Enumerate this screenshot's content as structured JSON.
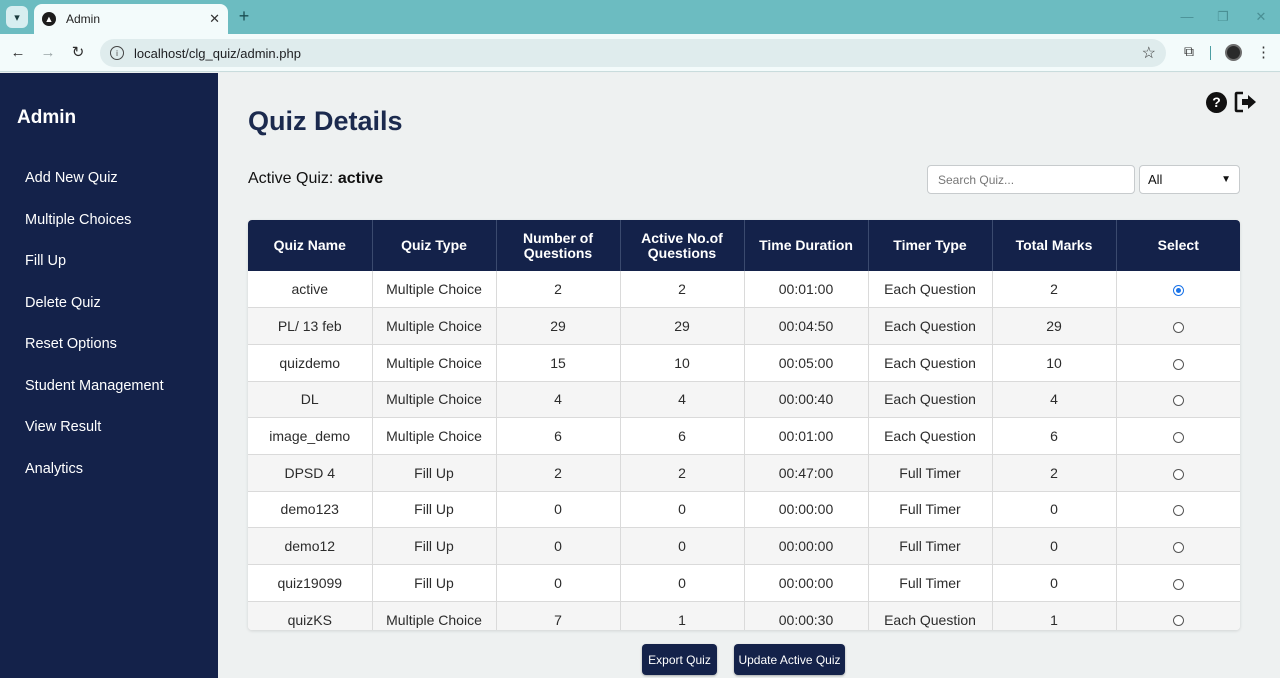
{
  "browser": {
    "tab_title": "Admin",
    "url": "localhost/clg_quiz/admin.php"
  },
  "sidebar": {
    "title": "Admin",
    "items": [
      {
        "label": "Add New Quiz"
      },
      {
        "label": "Multiple Choices"
      },
      {
        "label": "Fill Up"
      },
      {
        "label": "Delete Quiz"
      },
      {
        "label": "Reset Options"
      },
      {
        "label": "Student Management"
      },
      {
        "label": "View Result"
      },
      {
        "label": "Analytics"
      }
    ]
  },
  "main": {
    "title": "Quiz Details",
    "active_label": "Active Quiz:",
    "active_value": "active",
    "search_placeholder": "Search Quiz...",
    "filter_value": "All"
  },
  "table": {
    "headers": [
      "Quiz Name",
      "Quiz Type",
      "Number of Questions",
      "Active No.of Questions",
      "Time Duration",
      "Timer Type",
      "Total Marks",
      "Select"
    ],
    "rows": [
      {
        "name": "active",
        "type": "Multiple Choice",
        "num": "2",
        "active_num": "2",
        "duration": "00:01:00",
        "timer": "Each Question",
        "marks": "2",
        "selected": true
      },
      {
        "name": "PL/ 13 feb",
        "type": "Multiple Choice",
        "num": "29",
        "active_num": "29",
        "duration": "00:04:50",
        "timer": "Each Question",
        "marks": "29",
        "selected": false
      },
      {
        "name": "quizdemo",
        "type": "Multiple Choice",
        "num": "15",
        "active_num": "10",
        "duration": "00:05:00",
        "timer": "Each Question",
        "marks": "10",
        "selected": false
      },
      {
        "name": "DL",
        "type": "Multiple Choice",
        "num": "4",
        "active_num": "4",
        "duration": "00:00:40",
        "timer": "Each Question",
        "marks": "4",
        "selected": false
      },
      {
        "name": "image_demo",
        "type": "Multiple Choice",
        "num": "6",
        "active_num": "6",
        "duration": "00:01:00",
        "timer": "Each Question",
        "marks": "6",
        "selected": false
      },
      {
        "name": "DPSD 4",
        "type": "Fill Up",
        "num": "2",
        "active_num": "2",
        "duration": "00:47:00",
        "timer": "Full Timer",
        "marks": "2",
        "selected": false
      },
      {
        "name": "demo123",
        "type": "Fill Up",
        "num": "0",
        "active_num": "0",
        "duration": "00:00:00",
        "timer": "Full Timer",
        "marks": "0",
        "selected": false
      },
      {
        "name": "demo12",
        "type": "Fill Up",
        "num": "0",
        "active_num": "0",
        "duration": "00:00:00",
        "timer": "Full Timer",
        "marks": "0",
        "selected": false
      },
      {
        "name": "quiz19099",
        "type": "Fill Up",
        "num": "0",
        "active_num": "0",
        "duration": "00:00:00",
        "timer": "Full Timer",
        "marks": "0",
        "selected": false
      },
      {
        "name": "quizKS",
        "type": "Multiple Choice",
        "num": "7",
        "active_num": "1",
        "duration": "00:00:30",
        "timer": "Each Question",
        "marks": "1",
        "selected": false
      }
    ]
  },
  "buttons": {
    "export": "Export Quiz",
    "update": "Update Active Quiz"
  }
}
